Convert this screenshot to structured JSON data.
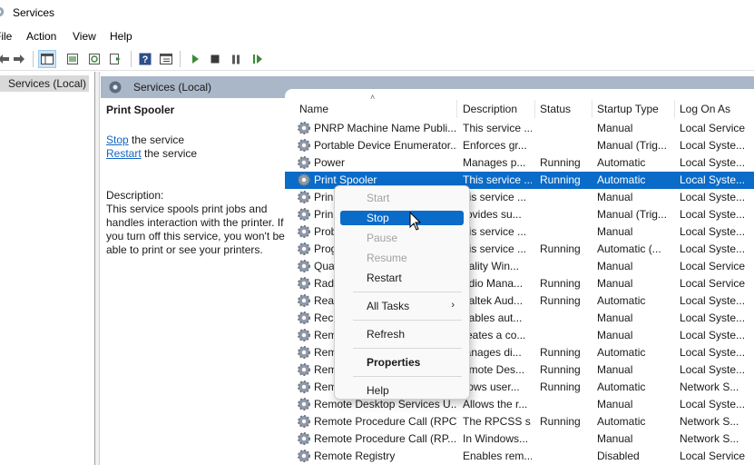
{
  "window": {
    "title": "Services"
  },
  "menu": [
    "File",
    "Action",
    "View",
    "Help"
  ],
  "tree": {
    "selected": "Services (Local)"
  },
  "pane": {
    "title": "Services (Local)"
  },
  "extended": {
    "service_name": "Print Spooler",
    "stop_link": "Stop",
    "stop_rest": "the service",
    "restart_link": "Restart",
    "restart_rest": "the service",
    "desc_label": "Description:",
    "desc_text": "This service spools print jobs and handles interaction with the printer. If you turn off this service, you won't be able to print or see your printers."
  },
  "columns": [
    "Name",
    "Description",
    "Status",
    "Startup Type",
    "Log On As"
  ],
  "rows": [
    {
      "name": "PNRP Machine Name Publi...",
      "desc": "This service ...",
      "status": "",
      "startup": "Manual",
      "logon": "Local Service"
    },
    {
      "name": "Portable Device Enumerator...",
      "desc": "Enforces gr...",
      "status": "",
      "startup": "Manual (Trig...",
      "logon": "Local Syste..."
    },
    {
      "name": "Power",
      "desc": "Manages p...",
      "status": "Running",
      "startup": "Automatic",
      "logon": "Local Syste..."
    },
    {
      "name": "Print Spooler",
      "desc": "This service ...",
      "status": "Running",
      "startup": "Automatic",
      "logon": "Local Syste...",
      "selected": true
    },
    {
      "name": "Prin",
      "desc": "his service ...",
      "status": "",
      "startup": "Manual",
      "logon": "Local Syste..."
    },
    {
      "name": "Prin",
      "desc": "rovides su...",
      "status": "",
      "startup": "Manual (Trig...",
      "logon": "Local Syste..."
    },
    {
      "name": "Prob",
      "desc": "his service ...",
      "status": "",
      "startup": "Manual",
      "logon": "Local Syste..."
    },
    {
      "name": "Prog",
      "desc": "his service ...",
      "status": "Running",
      "startup": "Automatic (...",
      "logon": "Local Syste..."
    },
    {
      "name": "Qua",
      "desc": "uality Win...",
      "status": "",
      "startup": "Manual",
      "logon": "Local Service"
    },
    {
      "name": "Rad",
      "desc": "adio Mana...",
      "status": "Running",
      "startup": "Manual",
      "logon": "Local Service"
    },
    {
      "name": "Rea",
      "desc": "ealtek Aud...",
      "status": "Running",
      "startup": "Automatic",
      "logon": "Local Syste..."
    },
    {
      "name": "Rec",
      "desc": "nables aut...",
      "status": "",
      "startup": "Manual",
      "logon": "Local Syste..."
    },
    {
      "name": "Rem",
      "desc": "reates a co...",
      "status": "",
      "startup": "Manual",
      "logon": "Local Syste..."
    },
    {
      "name": "Rem",
      "desc": "lanages di...",
      "status": "Running",
      "startup": "Automatic",
      "logon": "Local Syste..."
    },
    {
      "name": "Rem",
      "desc": "emote Des...",
      "status": "Running",
      "startup": "Manual",
      "logon": "Local Syste..."
    },
    {
      "name": "Rem",
      "desc": "llows user...",
      "status": "Running",
      "startup": "Automatic",
      "logon": "Network S..."
    },
    {
      "name": "Remote Desktop Services U...",
      "desc": "Allows the r...",
      "status": "",
      "startup": "Manual",
      "logon": "Local Syste..."
    },
    {
      "name": "Remote Procedure Call (RPC)",
      "desc": "The RPCSS s...",
      "status": "Running",
      "startup": "Automatic",
      "logon": "Network S..."
    },
    {
      "name": "Remote Procedure Call (RP...",
      "desc": "In Windows...",
      "status": "",
      "startup": "Manual",
      "logon": "Network S..."
    },
    {
      "name": "Remote Registry",
      "desc": "Enables rem...",
      "status": "",
      "startup": "Disabled",
      "logon": "Local Service"
    }
  ],
  "context_menu": {
    "start": "Start",
    "stop": "Stop",
    "pause": "Pause",
    "resume": "Resume",
    "restart": "Restart",
    "all_tasks": "All Tasks",
    "refresh": "Refresh",
    "properties": "Properties",
    "help": "Help"
  },
  "colors": {
    "selection": "#0a6bc8",
    "header": "#aab7c9",
    "link": "#1565c0"
  }
}
